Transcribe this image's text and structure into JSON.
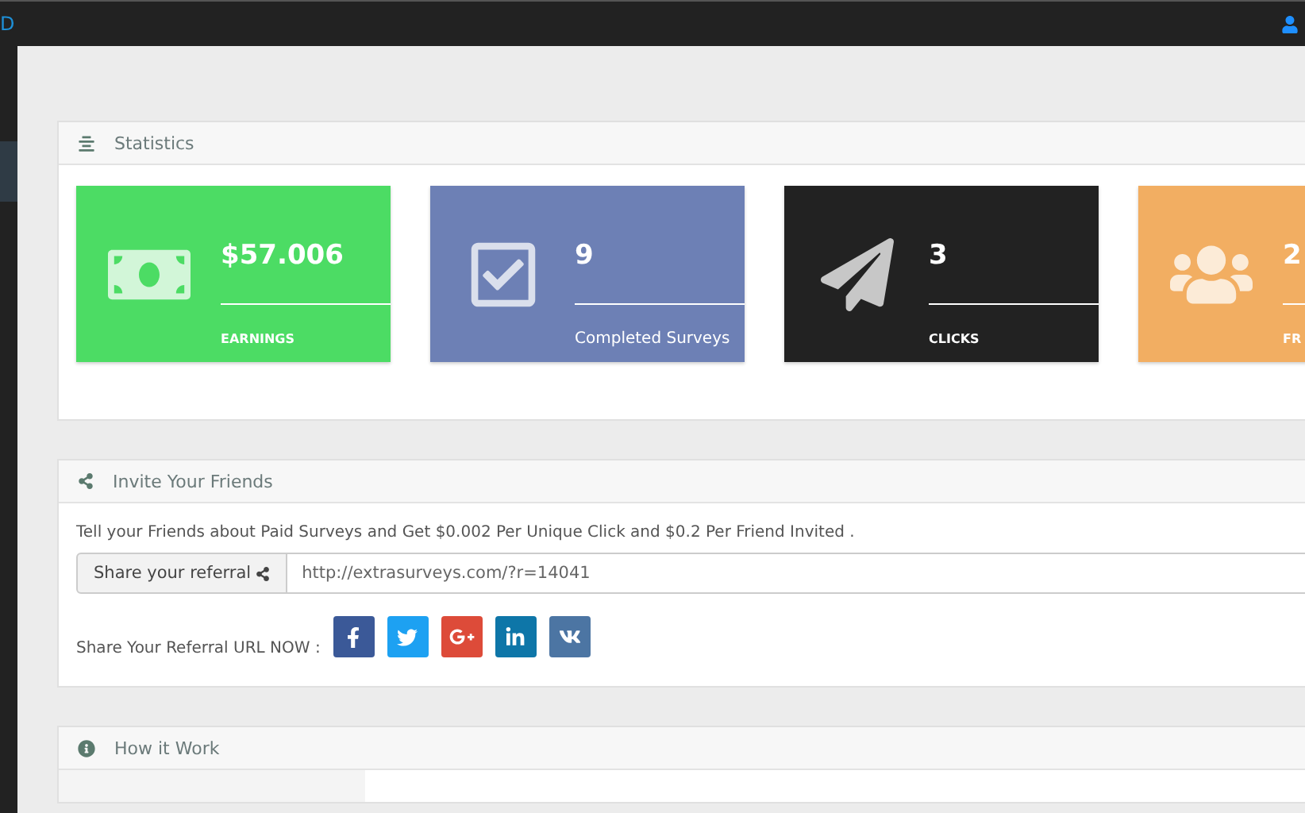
{
  "topbar": {
    "brand": "D"
  },
  "statistics": {
    "title": "Statistics",
    "cards": [
      {
        "kind": "money",
        "value": "$57.006",
        "label": "EARNINGS",
        "color": "#4cdc64"
      },
      {
        "kind": "check",
        "value": "9",
        "label": "Completed Surveys",
        "color": "#6d80b5"
      },
      {
        "kind": "plane",
        "value": "3",
        "label": "CLICKS",
        "color": "#222222"
      },
      {
        "kind": "users",
        "value": "2",
        "label": "FR",
        "color": "#f2ae62"
      }
    ]
  },
  "invite": {
    "title": "Invite Your Friends",
    "text": "Tell your Friends about Paid Surveys and Get $0.002 Per Unique Click and $0.2 Per Friend Invited .",
    "addon": "Share your referral",
    "referral_url": "http://extrasurveys.com/?r=14041",
    "share_label": "Share Your Referral URL NOW :",
    "social": [
      {
        "kind": "facebook",
        "color": "#3b5998"
      },
      {
        "kind": "twitter",
        "color": "#1da1f2"
      },
      {
        "kind": "googleplus",
        "color": "#dd4b39"
      },
      {
        "kind": "linkedin",
        "color": "#0e76a8"
      },
      {
        "kind": "vk",
        "color": "#4c75a3"
      }
    ]
  },
  "how_it_works": {
    "title": "How it Work"
  }
}
